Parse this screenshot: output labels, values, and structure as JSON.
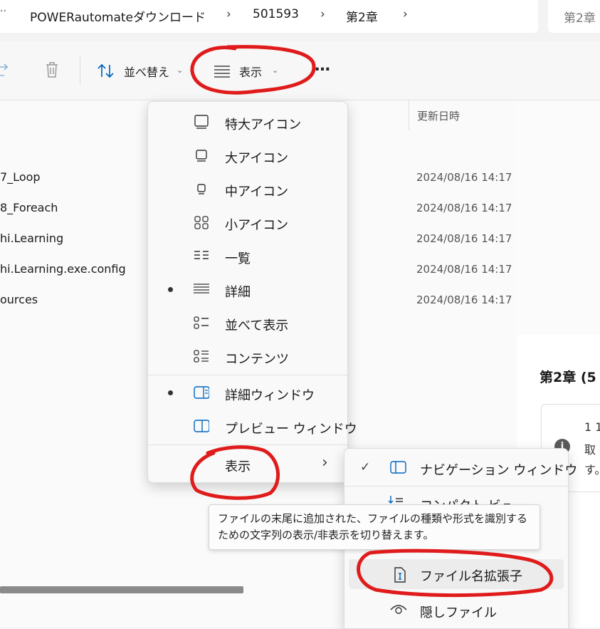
{
  "address": {
    "crumbs": [
      "POWERautomateダウンロード",
      "501593",
      "第2章"
    ],
    "search_placeholder": "第2章"
  },
  "toolbar": {
    "sort_label": "並べ替え",
    "view_label": "表示",
    "more_label": "…"
  },
  "list": {
    "date_header": "更新日時",
    "rows": [
      {
        "name": "7_Loop",
        "date": "2024/08/16 14:17"
      },
      {
        "name": "8_Foreach",
        "date": "2024/08/16 14:17"
      },
      {
        "name": "hi.Learning",
        "date": "2024/08/16 14:17"
      },
      {
        "name": "hi.Learning.exe.config",
        "date": "2024/08/16 14:17"
      },
      {
        "name": "ources",
        "date": "2024/08/16 14:17"
      }
    ]
  },
  "details_pane": {
    "title": "第2章 (5",
    "info_lines": [
      "1 1",
      "取",
      "す。"
    ]
  },
  "view_menu": {
    "items": [
      {
        "label": "特大アイコン",
        "icon": "extra-large-icons-icon",
        "selected": false
      },
      {
        "label": "大アイコン",
        "icon": "large-icons-icon",
        "selected": false
      },
      {
        "label": "中アイコン",
        "icon": "medium-icons-icon",
        "selected": false
      },
      {
        "label": "小アイコン",
        "icon": "small-icons-icon",
        "selected": false
      },
      {
        "label": "一覧",
        "icon": "list-icon",
        "selected": false
      },
      {
        "label": "詳細",
        "icon": "details-icon",
        "selected": true
      },
      {
        "label": "並べて表示",
        "icon": "tiles-icon",
        "selected": false
      },
      {
        "label": "コンテンツ",
        "icon": "content-icon",
        "selected": false
      }
    ],
    "pane_items": [
      {
        "label": "詳細ウィンドウ",
        "icon": "details-pane-icon",
        "selected": true
      },
      {
        "label": "プレビュー ウィンドウ",
        "icon": "preview-pane-icon",
        "selected": false
      }
    ],
    "show_label": "表示",
    "show_chevron": "›"
  },
  "show_submenu": {
    "items": [
      {
        "label": "ナビゲーション ウィンドウ",
        "icon": "navigation-pane-icon",
        "checked": true
      },
      {
        "label": "コンパクト ビュー",
        "icon": "compact-view-icon",
        "checked": false
      },
      {
        "label": "ファイル名拡張子",
        "icon": "file-extension-icon",
        "checked": false
      },
      {
        "label": "隠しファイル",
        "icon": "eye-icon",
        "checked": false
      }
    ],
    "check_glyph": "✓"
  },
  "tooltip": {
    "text_line1": "ファイルの末尾に追加された、ファイルの種類や形式を識別する",
    "text_line2": "ための文字列の表示/非表示を切り替えます。"
  },
  "colors": {
    "accent": "#0067c0",
    "annotation_red": "#e01b1b"
  }
}
